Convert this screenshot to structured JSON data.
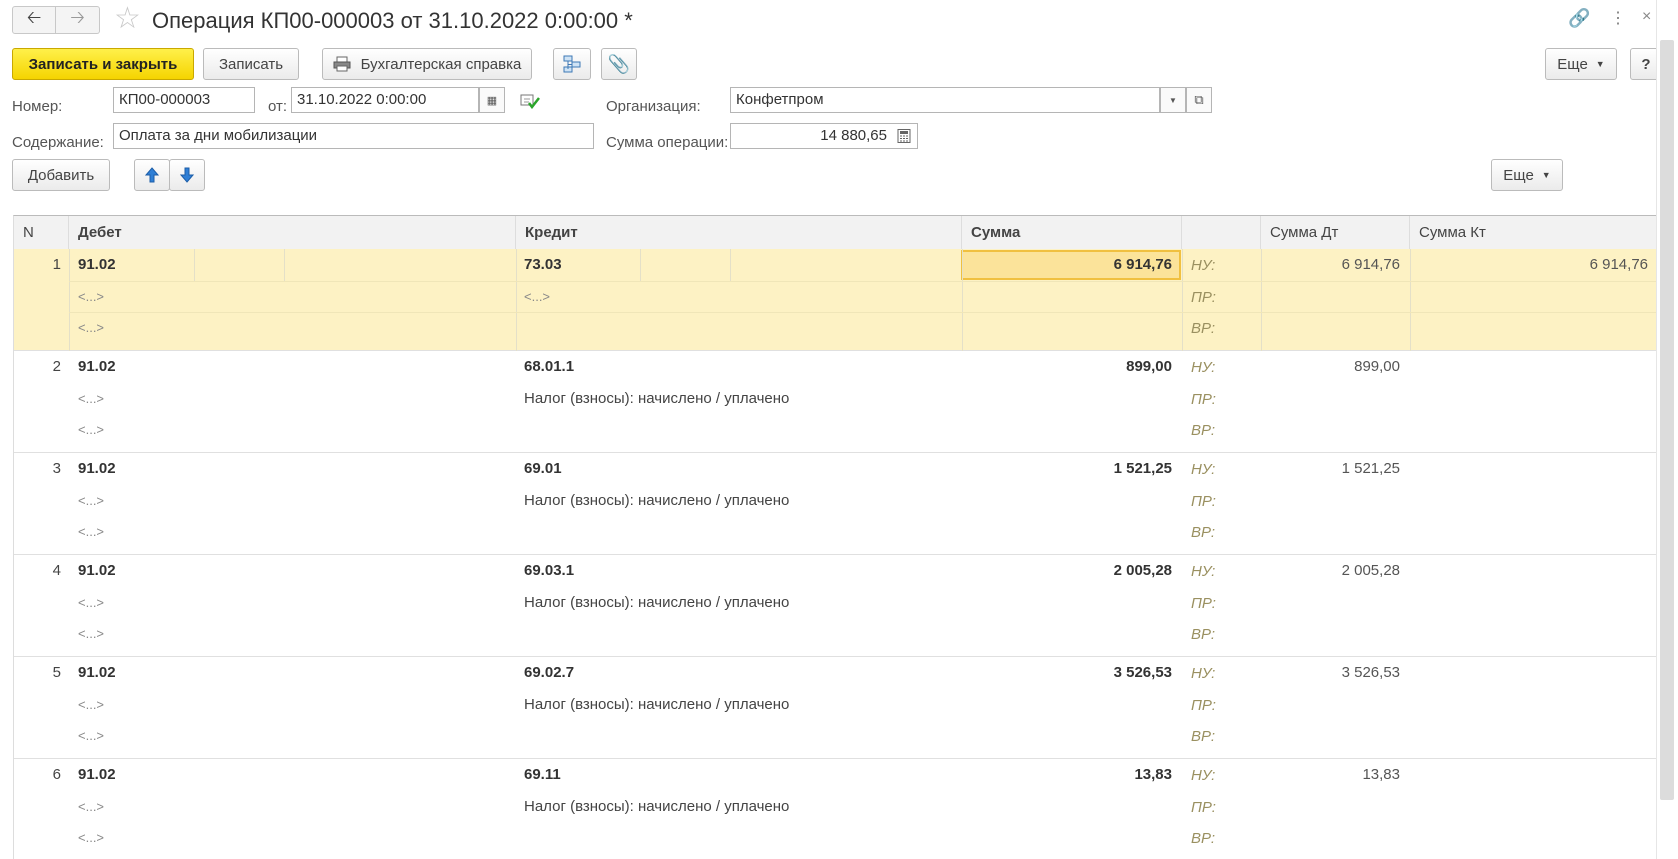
{
  "window": {
    "title": "Операция КП00-000003 от 31.10.2022 0:00:00 *"
  },
  "toolbar": {
    "save_close": "Записать и закрыть",
    "save": "Записать",
    "report": "Бухгалтерская справка",
    "more": "Еще"
  },
  "form": {
    "number_label": "Номер:",
    "number_value": "КП00-000003",
    "date_label": "от:",
    "date_value": "31.10.2022  0:00:00",
    "org_label": "Организация:",
    "org_value": "Конфетпром",
    "content_label": "Содержание:",
    "content_value": "Оплата за дни мобилизации",
    "sum_label": "Сумма операции:",
    "sum_value": "14 880,65"
  },
  "table_toolbar": {
    "add": "Добавить",
    "more": "Еще"
  },
  "table": {
    "headers": {
      "n": "N",
      "debit": "Дебет",
      "credit": "Кредит",
      "sum": "Сумма",
      "sum_dt": "Сумма Дт",
      "sum_kt": "Сумма Кт"
    },
    "tags": {
      "nu": "НУ:",
      "pr": "ПР:",
      "vr": "ВР:"
    },
    "placeholder": "<...>",
    "rows": [
      {
        "n": "1",
        "debit": "91.02",
        "credit": "73.03",
        "credit_desc": "",
        "sum": "6 914,76",
        "sum_dt": "6 914,76",
        "sum_kt": "6 914,76"
      },
      {
        "n": "2",
        "debit": "91.02",
        "credit": "68.01.1",
        "credit_desc": "Налог (взносы): начислено / уплачено",
        "sum": "899,00",
        "sum_dt": "899,00",
        "sum_kt": ""
      },
      {
        "n": "3",
        "debit": "91.02",
        "credit": "69.01",
        "credit_desc": "Налог (взносы): начислено / уплачено",
        "sum": "1 521,25",
        "sum_dt": "1 521,25",
        "sum_kt": ""
      },
      {
        "n": "4",
        "debit": "91.02",
        "credit": "69.03.1",
        "credit_desc": "Налог (взносы): начислено / уплачено",
        "sum": "2 005,28",
        "sum_dt": "2 005,28",
        "sum_kt": ""
      },
      {
        "n": "5",
        "debit": "91.02",
        "credit": "69.02.7",
        "credit_desc": "Налог (взносы): начислено / уплачено",
        "sum": "3 526,53",
        "sum_dt": "3 526,53",
        "sum_kt": ""
      },
      {
        "n": "6",
        "debit": "91.02",
        "credit": "69.11",
        "credit_desc": "Налог (взносы): начислено / уплачено",
        "sum": "13,83",
        "sum_dt": "13,83",
        "sum_kt": ""
      }
    ]
  }
}
